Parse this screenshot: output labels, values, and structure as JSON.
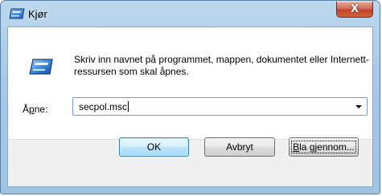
{
  "window": {
    "title": "Kjør",
    "close_symbol": "X",
    "icons": {
      "title": "run-icon",
      "close": "close-icon"
    }
  },
  "content": {
    "description": "Skriv inn navnet på programmet, mappen, dokumentet eller Internett-ressursen som skal åpnes.",
    "open_label_prefix": "Å",
    "open_label_mnemonic": "p",
    "open_label_suffix": "ne:",
    "open_value": "secpol.msc"
  },
  "buttons": {
    "ok": "OK",
    "cancel": "Avbryt",
    "browse_mnemonic": "B",
    "browse_rest": "la gjennom..."
  },
  "colors": {
    "titlebar": "#a7c9e6",
    "close_button": "#c2432a",
    "footer": "#f0f0f0",
    "default_button_border": "#3c7fb1"
  }
}
